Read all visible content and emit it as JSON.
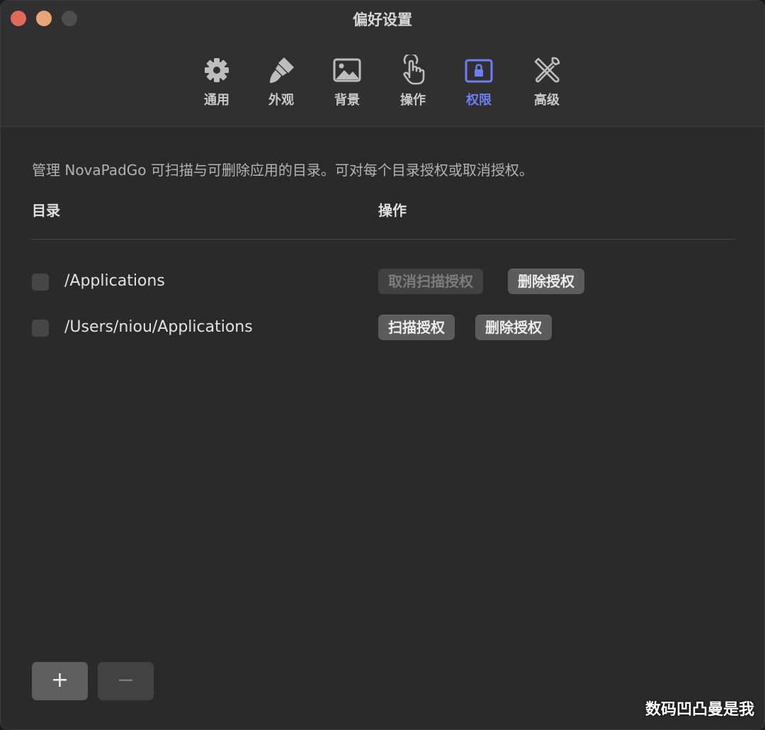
{
  "window": {
    "title": "偏好设置"
  },
  "tabs": [
    {
      "label": "通用",
      "icon": "gear-icon"
    },
    {
      "label": "外观",
      "icon": "paintbrush-icon"
    },
    {
      "label": "背景",
      "icon": "image-icon"
    },
    {
      "label": "操作",
      "icon": "hand-pointer-icon"
    },
    {
      "label": "权限",
      "icon": "lock-icon",
      "active": true
    },
    {
      "label": "高级",
      "icon": "tools-icon"
    }
  ],
  "permissions": {
    "description": "管理 NovaPadGo 可扫描与可删除应用的目录。可对每个目录授权或取消授权。",
    "col_directory": "目录",
    "col_action": "操作",
    "rows": [
      {
        "path": "/Applications",
        "scan_label": "取消扫描授权",
        "scan_disabled": true,
        "delete_label": "删除授权"
      },
      {
        "path": "/Users/niou/Applications",
        "scan_label": "扫描授权",
        "scan_disabled": false,
        "delete_label": "删除授权"
      }
    ],
    "add_label": "+",
    "remove_label": "−"
  },
  "watermark": "数码凹凸曼是我",
  "colors": {
    "accent": "#6f7df5",
    "background": "#2a2a2a",
    "toolbar": "#303030"
  }
}
